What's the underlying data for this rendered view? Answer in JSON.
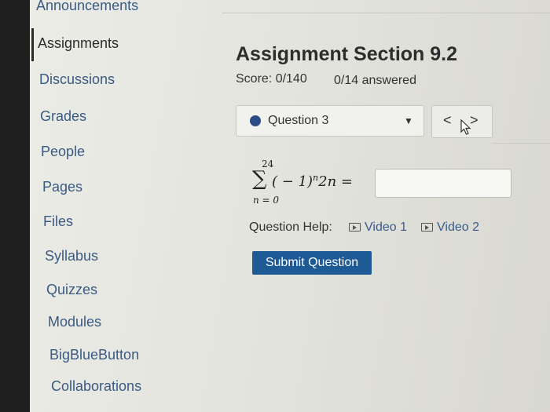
{
  "nav": {
    "items": [
      {
        "label": "Announcements"
      },
      {
        "label": "Assignments"
      },
      {
        "label": "Discussions"
      },
      {
        "label": "Grades"
      },
      {
        "label": "People"
      },
      {
        "label": "Pages"
      },
      {
        "label": "Files"
      },
      {
        "label": "Syllabus"
      },
      {
        "label": "Quizzes"
      },
      {
        "label": "Modules"
      },
      {
        "label": "BigBlueButton"
      },
      {
        "label": "Collaborations"
      }
    ],
    "active_item": "Assignments"
  },
  "assignment": {
    "title": "Assignment Section 9.2",
    "score": "Score: 0/140",
    "answered": "0/14 answered"
  },
  "question_selector": {
    "selected": "Question 3",
    "prev_label": "<",
    "next_label": ">"
  },
  "question": {
    "sum_upper": "24",
    "sum_lower": "n = 0",
    "sigma": "∑",
    "expr_base": "( − 1)",
    "expr_exp": "n",
    "expr_tail": "2n =",
    "answer_value": ""
  },
  "help": {
    "label": "Question Help:",
    "video1": "Video 1",
    "video2": "Video 2"
  },
  "submit": {
    "label": "Submit Question"
  },
  "colors": {
    "link": "#3a5a84",
    "button": "#1d5a96",
    "question_dot": "#2b4a86"
  }
}
